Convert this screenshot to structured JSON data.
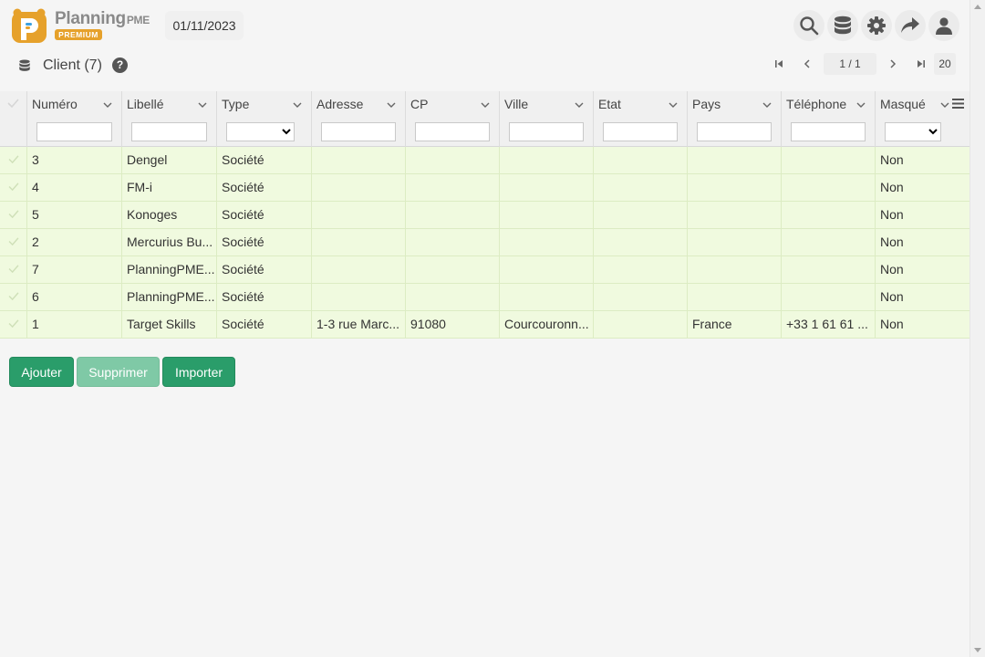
{
  "brand": {
    "name": "Planning",
    "suffix": "PME",
    "badge": "PREMIUM"
  },
  "date": "01/11/2023",
  "toolbar_icons": [
    "search-icon",
    "database-icon",
    "gear-icon",
    "share-icon",
    "user-icon"
  ],
  "section": {
    "title": "Client (7)",
    "help": "?"
  },
  "pager": {
    "current": "1 / 1",
    "page_size": "20"
  },
  "columns": [
    {
      "label": "Numéro",
      "filter": "input"
    },
    {
      "label": "Libellé",
      "filter": "input"
    },
    {
      "label": "Type",
      "filter": "select"
    },
    {
      "label": "Adresse",
      "filter": "input"
    },
    {
      "label": "CP",
      "filter": "input"
    },
    {
      "label": "Ville",
      "filter": "input"
    },
    {
      "label": "Etat",
      "filter": "input"
    },
    {
      "label": "Pays",
      "filter": "input"
    },
    {
      "label": "Téléphone",
      "filter": "input"
    },
    {
      "label": "Masqué",
      "filter": "select"
    }
  ],
  "rows": [
    [
      "3",
      "Dengel",
      "Société",
      "",
      "",
      "",
      "",
      "",
      "",
      "Non"
    ],
    [
      "4",
      "FM-i",
      "Société",
      "",
      "",
      "",
      "",
      "",
      "",
      "Non"
    ],
    [
      "5",
      "Konoges",
      "Société",
      "",
      "",
      "",
      "",
      "",
      "",
      "Non"
    ],
    [
      "2",
      "Mercurius Bu...",
      "Société",
      "",
      "",
      "",
      "",
      "",
      "",
      "Non"
    ],
    [
      "7",
      "PlanningPME...",
      "Société",
      "",
      "",
      "",
      "",
      "",
      "",
      "Non"
    ],
    [
      "6",
      "PlanningPME...",
      "Société",
      "",
      "",
      "",
      "",
      "",
      "",
      "Non"
    ],
    [
      "1",
      "Target Skills",
      "Société",
      "1-3 rue Marc...",
      "91080",
      "Courcouronn...",
      "",
      "France",
      "+33 1 61 61 ...",
      "Non"
    ]
  ],
  "buttons": {
    "add": "Ajouter",
    "delete": "Supprimer",
    "import": "Importer"
  },
  "colors": {
    "accent": "#2a9d6a",
    "row_bg": "#f0fadf",
    "brand_orange": "#e6a12b"
  }
}
